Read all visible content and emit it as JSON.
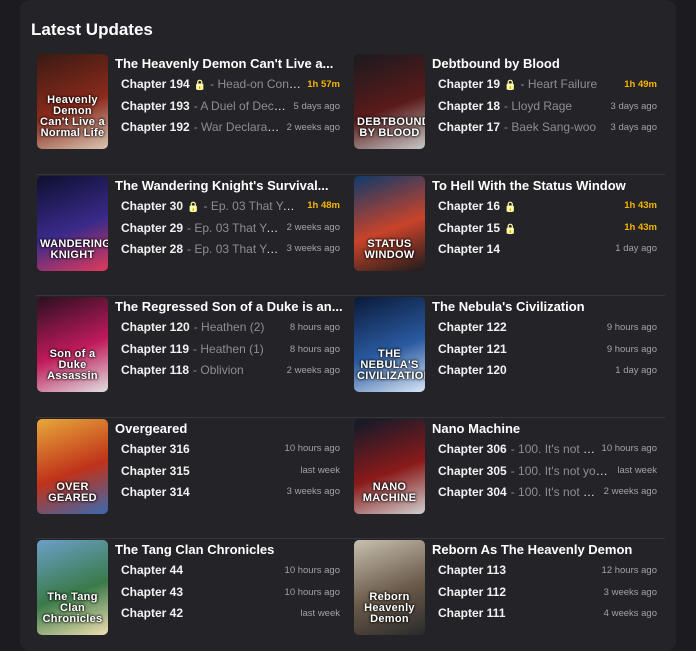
{
  "section_title": "Latest Updates",
  "colors": {
    "accent_new": "#f5b400",
    "lock": "#f5a524"
  },
  "series": [
    {
      "title": "The Heavenly Demon Can't Live a...",
      "cover_text": "Heavenly Demon Can't Live a Normal Life",
      "cover_colors": [
        "#3a1a12",
        "#8a2a1c",
        "#d9c7b3"
      ],
      "chapters": [
        {
          "num": "Chapter 194",
          "locked": true,
          "name": "- Head-on Confro...",
          "time": "1h 57m",
          "new": true
        },
        {
          "num": "Chapter 193",
          "locked": false,
          "name": "- A Duel of Decisi...",
          "time": "5 days ago",
          "new": false
        },
        {
          "num": "Chapter 192",
          "locked": false,
          "name": "- War Declaration",
          "time": "2 weeks ago",
          "new": false
        }
      ]
    },
    {
      "title": "Debtbound by Blood",
      "cover_text": "DEBTBOUND BY BLOOD",
      "cover_colors": [
        "#1a1a1e",
        "#5a1a1a",
        "#c9c9c9"
      ],
      "chapters": [
        {
          "num": "Chapter 19",
          "locked": true,
          "name": "- Heart Failure",
          "time": "1h 49m",
          "new": true
        },
        {
          "num": "Chapter 18",
          "locked": false,
          "name": "- Lloyd Rage",
          "time": "3 days ago",
          "new": false
        },
        {
          "num": "Chapter 17",
          "locked": false,
          "name": "- Baek Sang-woo",
          "time": "3 days ago",
          "new": false
        }
      ]
    },
    {
      "title": "The Wandering Knight's Survival...",
      "cover_text": "WANDERING KNIGHT",
      "cover_colors": [
        "#0d1030",
        "#3a2a8a",
        "#e23a5a"
      ],
      "chapters": [
        {
          "num": "Chapter 30",
          "locked": true,
          "name": "- Ep. 03 That Year,...",
          "time": "1h 48m",
          "new": true
        },
        {
          "num": "Chapter 29",
          "locked": false,
          "name": "- Ep. 03 That Yea...",
          "time": "2 weeks ago",
          "new": false
        },
        {
          "num": "Chapter 28",
          "locked": false,
          "name": "- Ep. 03 That Yea...",
          "time": "3 weeks ago",
          "new": false
        }
      ]
    },
    {
      "title": "To Hell With the Status Window",
      "cover_text": "STATUS WINDOW",
      "cover_colors": [
        "#0f3a6a",
        "#c9432a",
        "#1c1c1c"
      ],
      "chapters": [
        {
          "num": "Chapter 16",
          "locked": true,
          "name": "",
          "time": "1h 43m",
          "new": true
        },
        {
          "num": "Chapter 15",
          "locked": true,
          "name": "",
          "time": "1h 43m",
          "new": true
        },
        {
          "num": "Chapter 14",
          "locked": false,
          "name": "",
          "time": "1 day ago",
          "new": false
        }
      ]
    },
    {
      "title": "The Regressed Son of a Duke is an...",
      "cover_text": "Son of a Duke Assassin",
      "cover_colors": [
        "#2a1020",
        "#c01a5a",
        "#e0e0e0"
      ],
      "chapters": [
        {
          "num": "Chapter 120",
          "locked": false,
          "name": "- Heathen (2)",
          "time": "8 hours ago",
          "new": false
        },
        {
          "num": "Chapter 119",
          "locked": false,
          "name": "- Heathen (1)",
          "time": "8 hours ago",
          "new": false
        },
        {
          "num": "Chapter 118",
          "locked": false,
          "name": "- Oblivion",
          "time": "2 weeks ago",
          "new": false
        }
      ]
    },
    {
      "title": "The Nebula's Civilization",
      "cover_text": "THE NEBULA'S CIVILIZATION",
      "cover_colors": [
        "#0a1a3a",
        "#2a5aa0",
        "#d8e6f5"
      ],
      "chapters": [
        {
          "num": "Chapter 122",
          "locked": false,
          "name": "",
          "time": "9 hours ago",
          "new": false
        },
        {
          "num": "Chapter 121",
          "locked": false,
          "name": "",
          "time": "9 hours ago",
          "new": false
        },
        {
          "num": "Chapter 120",
          "locked": false,
          "name": "",
          "time": "1 day ago",
          "new": false
        }
      ]
    },
    {
      "title": "Overgeared",
      "cover_text": "OVER GEARED",
      "cover_colors": [
        "#e8a83a",
        "#c0321a",
        "#3a6ab0"
      ],
      "chapters": [
        {
          "num": "Chapter 316",
          "locked": false,
          "name": "",
          "time": "10 hours ago",
          "new": false
        },
        {
          "num": "Chapter 315",
          "locked": false,
          "name": "",
          "time": "last week",
          "new": false
        },
        {
          "num": "Chapter 314",
          "locked": false,
          "name": "",
          "time": "3 weeks ago",
          "new": false
        }
      ]
    },
    {
      "title": "Nano Machine",
      "cover_text": "NANO MACHINE",
      "cover_colors": [
        "#0e1a2a",
        "#8a1a1a",
        "#d0d0d0"
      ],
      "chapters": [
        {
          "num": "Chapter 306",
          "locked": false,
          "name": "- 100. It's not y...",
          "time": "10 hours ago",
          "new": false
        },
        {
          "num": "Chapter 305",
          "locked": false,
          "name": "- 100. It's not you ...",
          "time": "last week",
          "new": false
        },
        {
          "num": "Chapter 304",
          "locked": false,
          "name": "- 100. It's not y...",
          "time": "2 weeks ago",
          "new": false
        }
      ]
    },
    {
      "title": "The Tang Clan Chronicles",
      "cover_text": "The Tang Clan Chronicles",
      "cover_colors": [
        "#6aa0c8",
        "#3a7a4a",
        "#f0e0b0"
      ],
      "chapters": [
        {
          "num": "Chapter 44",
          "locked": false,
          "name": "",
          "time": "10 hours ago",
          "new": false
        },
        {
          "num": "Chapter 43",
          "locked": false,
          "name": "",
          "time": "10 hours ago",
          "new": false
        },
        {
          "num": "Chapter 42",
          "locked": false,
          "name": "",
          "time": "last week",
          "new": false
        }
      ]
    },
    {
      "title": "Reborn As The Heavenly Demon",
      "cover_text": "Reborn Heavenly Demon",
      "cover_colors": [
        "#c8c0b0",
        "#6a5a4a",
        "#2a2a2a"
      ],
      "chapters": [
        {
          "num": "Chapter 113",
          "locked": false,
          "name": "",
          "time": "12 hours ago",
          "new": false
        },
        {
          "num": "Chapter 112",
          "locked": false,
          "name": "",
          "time": "3 weeks ago",
          "new": false
        },
        {
          "num": "Chapter 111",
          "locked": false,
          "name": "",
          "time": "4 weeks ago",
          "new": false
        }
      ]
    }
  ]
}
